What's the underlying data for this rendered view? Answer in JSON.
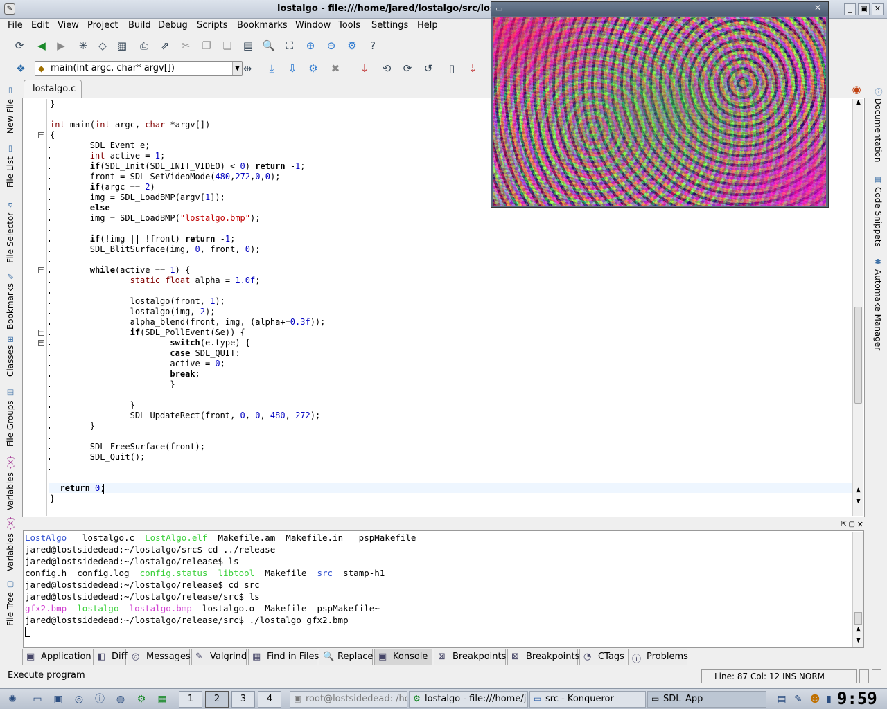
{
  "window": {
    "title": "lostalgo - file:///home/jared/lostalgo/src/lost"
  },
  "menu": [
    "File",
    "Edit",
    "View",
    "Project",
    "Build",
    "Debug",
    "Scripts",
    "Bookmarks",
    "Window",
    "Tools",
    "Settings",
    "Help"
  ],
  "function_combo": {
    "value": "main(int argc, char* argv[])"
  },
  "file_tab": {
    "label": "lostalgo.c"
  },
  "left_tabs": [
    "New File",
    "File List",
    "File Selector",
    "Bookmarks",
    "Classes",
    "File Groups",
    "Variables",
    "Variables",
    "File Tree"
  ],
  "right_tabs": [
    "Documentation",
    "Code Snippets",
    "Automake Manager"
  ],
  "code_lines": [
    "}",
    "",
    "int main(int argc, char *argv[])",
    "{",
    "        SDL_Event e;",
    "        int active = 1;",
    "        if(SDL_Init(SDL_INIT_VIDEO) < 0) return -1;",
    "        front = SDL_SetVideoMode(480,272,0,0);",
    "        if(argc == 2)",
    "        img = SDL_LoadBMP(argv[1]);",
    "        else",
    "        img = SDL_LoadBMP(\"lostalgo.bmp\");",
    "",
    "        if(!img || !front) return -1;",
    "        SDL_BlitSurface(img, 0, front, 0);",
    "",
    "        while(active == 1) {",
    "                static float alpha = 1.0f;",
    "",
    "                lostalgo(front, 1);",
    "                lostalgo(img, 2);",
    "                alpha_blend(front, img, (alpha+=0.3f));",
    "                if(SDL_PollEvent(&e)) {",
    "                        switch(e.type) {",
    "                        case SDL_QUIT:",
    "                        active = 0;",
    "                        break;",
    "                        }",
    "",
    "                }",
    "                SDL_UpdateRect(front, 0, 0, 480, 272);",
    "        }",
    "",
    "        SDL_FreeSurface(front);",
    "        SDL_Quit();",
    "",
    "",
    "  return 0;",
    "}"
  ],
  "terminal": {
    "lines": [
      [
        {
          "t": "LostAlgo",
          "c": "bl"
        },
        {
          "t": "   lostalgo.c  "
        },
        {
          "t": "LostAlgo.elf",
          "c": "gr"
        },
        {
          "t": "  Makefile.am  Makefile.in   pspMakefile"
        }
      ],
      [
        {
          "t": "jared@lostsidedead:~/lostalgo/src$ cd ../release"
        }
      ],
      [
        {
          "t": "jared@lostsidedead:~/lostalgo/release$ ls"
        }
      ],
      [
        {
          "t": "config.h  config.log  "
        },
        {
          "t": "config.status",
          "c": "gr"
        },
        {
          "t": "  "
        },
        {
          "t": "libtool",
          "c": "gr"
        },
        {
          "t": "  Makefile  "
        },
        {
          "t": "src",
          "c": "bl"
        },
        {
          "t": "  stamp-h1"
        }
      ],
      [
        {
          "t": "jared@lostsidedead:~/lostalgo/release$ cd src"
        }
      ],
      [
        {
          "t": "jared@lostsidedead:~/lostalgo/release/src$ ls"
        }
      ],
      [
        {
          "t": "gfx2.bmp",
          "c": "mg"
        },
        {
          "t": "  "
        },
        {
          "t": "lostalgo",
          "c": "gr"
        },
        {
          "t": "  "
        },
        {
          "t": "lostalgo.bmp",
          "c": "mg"
        },
        {
          "t": "  lostalgo.o  Makefile  pspMakefile~"
        }
      ],
      [
        {
          "t": "jared@lostsidedead:~/lostalgo/release/src$ ./lostalgo gfx2.bmp"
        }
      ]
    ]
  },
  "bottom_tabs": [
    {
      "label": "Application",
      "icon": "application-icon"
    },
    {
      "label": "Diff",
      "icon": "diff-icon"
    },
    {
      "label": "Messages",
      "icon": "messages-icon"
    },
    {
      "label": "Valgrind",
      "icon": "valgrind-icon"
    },
    {
      "label": "Find in Files",
      "icon": "find-in-files-icon"
    },
    {
      "label": "Replace",
      "icon": "replace-icon"
    },
    {
      "label": "Konsole",
      "icon": "konsole-icon",
      "active": true
    },
    {
      "label": "Breakpoints",
      "icon": "breakpoints-icon"
    },
    {
      "label": "Breakpoints",
      "icon": "breakpoints-icon"
    },
    {
      "label": "CTags",
      "icon": "ctags-icon"
    },
    {
      "label": "Problems",
      "icon": "problems-icon"
    }
  ],
  "status": {
    "message": "Execute program",
    "position": "Line: 87 Col: 12  INS  NORM"
  },
  "taskbar": {
    "desktops": [
      "1",
      "2",
      "3",
      "4"
    ],
    "active_desktop": "2",
    "windows": [
      {
        "label": "root@lostsidedead: /ho"
      },
      {
        "label": "lostalgo - file:///home/ja"
      },
      {
        "label": "src - Konqueror"
      },
      {
        "label": "SDL_App",
        "active": true
      }
    ],
    "clock": "9:59"
  },
  "colors": {
    "string": "#c00000",
    "number": "#0000c0",
    "type": "#800000",
    "term_green": "#3ad03a",
    "term_magenta": "#d040d0",
    "term_blue": "#3050d0"
  }
}
